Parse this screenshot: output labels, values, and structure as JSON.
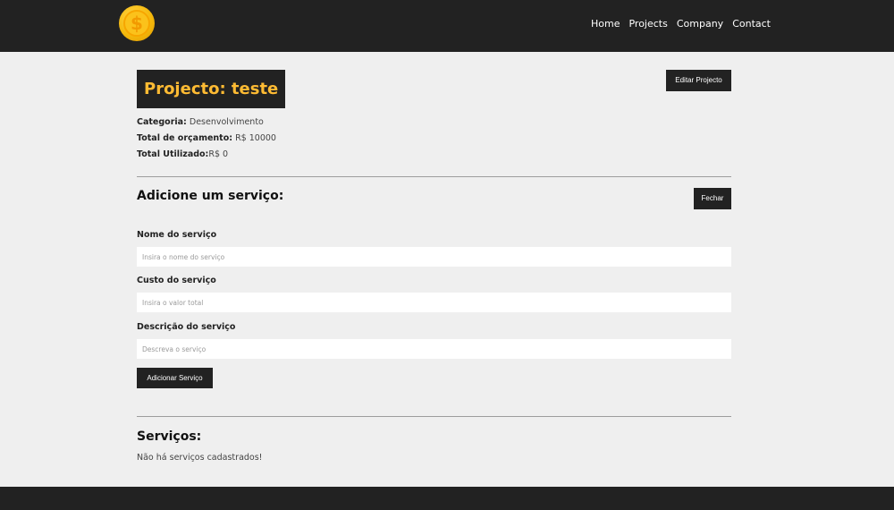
{
  "nav": {
    "logo_glyph": "$",
    "links": [
      "Home",
      "Projects",
      "Company",
      "Contact"
    ]
  },
  "project": {
    "title": "Projecto: teste",
    "edit_label": "Editar Projecto",
    "category_label": "Categoria:",
    "category_value": "Desenvolvimento",
    "budget_label": "Total de orçamento:",
    "budget_value": "R$ 10000",
    "used_label": "Total Utilizado:",
    "used_value": "R$ 0"
  },
  "service_form": {
    "title": "Adicione um serviço:",
    "close_label": "Fechar",
    "name_label": "Nome do serviço",
    "name_placeholder": "Insira o nome do serviço",
    "cost_label": "Custo do serviço",
    "cost_placeholder": "Insira o valor total",
    "desc_label": "Descrição do serviço",
    "desc_placeholder": "Descreva o serviço",
    "submit_label": "Adicionar Serviço"
  },
  "services": {
    "title": "Serviços:",
    "empty_message": "Não há serviços cadastrados!"
  },
  "colors": {
    "dark": "#222222",
    "accent": "#ffbb33",
    "background": "#efefef"
  }
}
